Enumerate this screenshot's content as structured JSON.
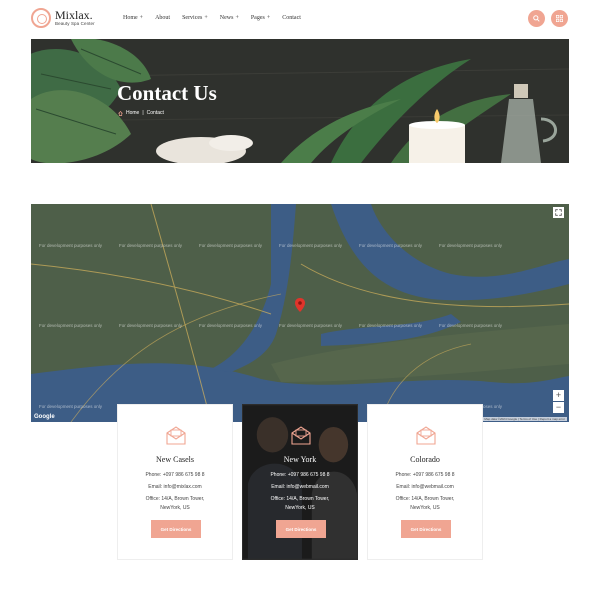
{
  "brand": {
    "name": "Mixlax.",
    "tagline": "Beauty Spa Center"
  },
  "nav": [
    {
      "label": "Home",
      "has_submenu": true
    },
    {
      "label": "About",
      "has_submenu": false
    },
    {
      "label": "Services",
      "has_submenu": true
    },
    {
      "label": "News",
      "has_submenu": true
    },
    {
      "label": "Pages",
      "has_submenu": true
    },
    {
      "label": "Contact",
      "has_submenu": false
    }
  ],
  "nav_plus": "+",
  "header_buttons": {
    "search_icon": "search-icon",
    "menu_icon": "grid-icon"
  },
  "hero": {
    "title": "Contact Us",
    "breadcrumb": {
      "home": "Home",
      "separator": "|",
      "current": "Contact"
    }
  },
  "map": {
    "watermark": "For development purposes only",
    "google_label": "Google",
    "terms_text": "Map data ©2024 Google | Terms of Use | Report a map error",
    "zoom_in": "+",
    "zoom_out": "−"
  },
  "locations": [
    {
      "name": "New Casels",
      "phone": "Phone: +097 986 675 98 8",
      "email": "Email: info@mixlax.com",
      "office_line1": "Office: 14/A, Brown Tower,",
      "office_line2": "NewYork, US",
      "button": "Get Directions"
    },
    {
      "name": "New York",
      "phone": "Phone: +097 986 675 98 8",
      "email": "Email: info@webmail.com",
      "office_line1": "Office: 14/A, Brown Tower,",
      "office_line2": "NewYork, US",
      "button": "Get Directions"
    },
    {
      "name": "Colorado",
      "phone": "Phone: +097 986 675 98 8",
      "email": "Email: info@webmail.com",
      "office_line1": "Office: 14/A, Brown Tower,",
      "office_line2": "NewYork, US",
      "button": "Get Directions"
    }
  ],
  "colors": {
    "accent": "#f0a592",
    "dark_card": "#2c2c2c",
    "map_land": "#4a5b47",
    "map_water": "#3d5d86"
  }
}
